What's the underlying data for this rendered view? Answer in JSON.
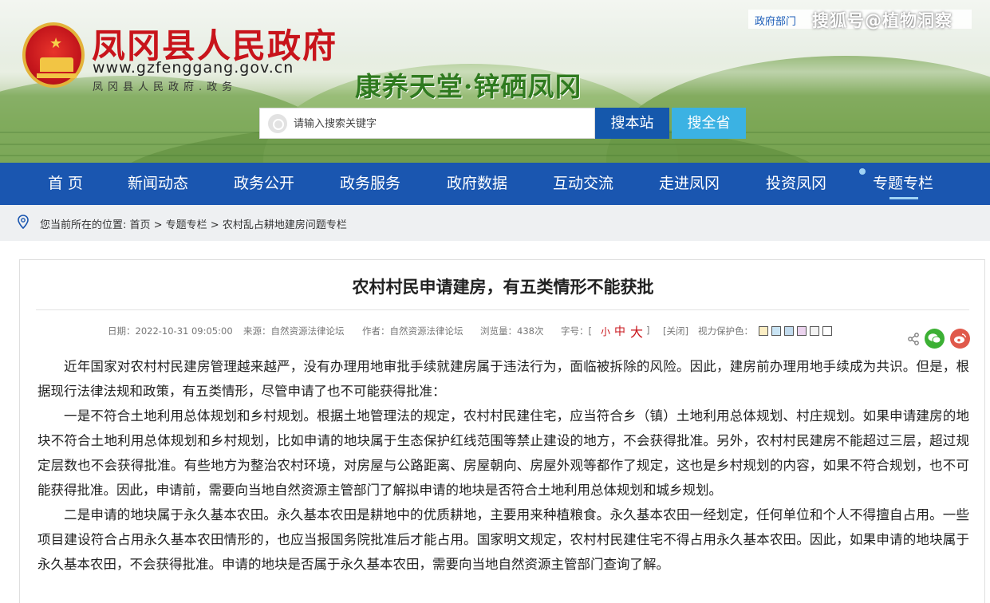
{
  "header": {
    "site_title": "凤冈县人民政府",
    "site_url": "www.gzfenggang.gov.cn",
    "site_subtitle": "凤冈县人民政府.政务",
    "slogan": "康养天堂·锌硒凤冈",
    "top_link": "政府部门",
    "watermark": "搜狐号@植物洞察"
  },
  "search": {
    "placeholder": "请输入搜索关键字",
    "btn_site": "搜本站",
    "btn_all": "搜全省"
  },
  "nav": {
    "items": [
      "首 页",
      "新闻动态",
      "政务公开",
      "政务服务",
      "政府数据",
      "互动交流",
      "走进凤冈",
      "投资凤冈",
      "专题专栏"
    ],
    "active": "专题专栏"
  },
  "breadcrumb": {
    "text": "您当前所在的位置: 首页 > 专题专栏 > 农村乱占耕地建房问题专栏"
  },
  "article": {
    "title": "农村村民申请建房，有五类情形不能获批",
    "meta": {
      "date": "日期：2022-10-31 09:05:00",
      "source": "来源：自然资源法律论坛",
      "author": "作者：自然资源法律论坛",
      "views": "浏览量：438次",
      "font_label": "字号：[",
      "size_small": "小",
      "size_mid": "中",
      "size_large": "大",
      "font_close": "]",
      "close": "[关闭]",
      "eye_label": "视力保护色："
    },
    "eye_colors": [
      "#fbeec4",
      "#c9e4f4",
      "#c2dbee",
      "#ebd3ee",
      "#f3f3f3",
      "#ffffff"
    ],
    "paragraphs": [
      "近年国家对农村村民建房管理越来越严，没有办理用地审批手续就建房属于违法行为，面临被拆除的风险。因此，建房前办理用地手续成为共识。但是，根据现行法律法规和政策，有五类情形，尽管申请了也不可能获得批准：",
      "一是不符合土地利用总体规划和乡村规划。根据土地管理法的规定，农村村民建住宅，应当符合乡（镇）土地利用总体规划、村庄规划。如果申请建房的地块不符合土地利用总体规划和乡村规划，比如申请的地块属于生态保护红线范围等禁止建设的地方，不会获得批准。另外，农村村民建房不能超过三层，超过规定层数也不会获得批准。有些地方为整治农村环境，对房屋与公路距离、房屋朝向、房屋外观等都作了规定，这也是乡村规划的内容，如果不符合规划，也不可能获得批准。因此，申请前，需要向当地自然资源主管部门了解拟申请的地块是否符合土地利用总体规划和城乡规划。",
      "二是申请的地块属于永久基本农田。永久基本农田是耕地中的优质耕地，主要用来种植粮食。永久基本农田一经划定，任何单位和个人不得擅自占用。一些项目建设符合占用永久基本农田情形的，也应当报国务院批准后才能占用。国家明文规定，农村村民建住宅不得占用永久基本农田。因此，如果申请的地块属于永久基本农田，不会获得批准。申请的地块是否属于永久基本农田，需要向当地自然资源主管部门查询了解。"
    ]
  },
  "colors": {
    "nav_bg": "#1a56b0",
    "title_red": "#c8141b",
    "btn_site": "#1558ac",
    "btn_all": "#3bb2e3"
  }
}
